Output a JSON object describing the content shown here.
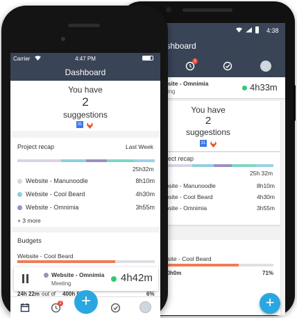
{
  "android": {
    "status_time": "4:38",
    "header_title": "Dashboard",
    "timer": {
      "project": "Website - Omnimia",
      "task": "Meeting",
      "time": "4h33m",
      "dot_color": "#2ecc71"
    },
    "clock_badge": "1",
    "suggestions": {
      "line1": "You have",
      "count": "2",
      "line2": "suggestions"
    },
    "recap": {
      "title": "Project recap",
      "total": "25h 32m",
      "items": [
        {
          "name": "Website - Manunoodle",
          "time": "8h10m",
          "color": "#d9d3e3"
        },
        {
          "name": "Website - Cool Beard",
          "time": "4h30m",
          "color": "#8fd0de"
        },
        {
          "name": "Website - Omnimia",
          "time": "3h55m",
          "color": "#9b8fc0"
        }
      ],
      "more": "+ 3 more"
    },
    "budget": {
      "name": "Website - Cool Beard",
      "of_text": "of",
      "total": "60h0m",
      "percent": "71%",
      "fill": 0.71
    },
    "fab_label": "+"
  },
  "iphone": {
    "carrier": "Carrier",
    "time": "4:47 PM",
    "header_title": "Dashboard",
    "suggestions": {
      "line1": "You have",
      "count": "2",
      "line2": "suggestions"
    },
    "recap": {
      "title": "Project recap",
      "period": "Last Week",
      "total": "25h32m",
      "items": [
        {
          "name": "Website - Manunoodle",
          "time": "8h10m",
          "color": "#d9d3e3"
        },
        {
          "name": "Website - Cool Beard",
          "time": "4h30m",
          "color": "#8fd0de"
        },
        {
          "name": "Website - Omnimia",
          "time": "3h55m",
          "color": "#9b8fc0"
        }
      ],
      "more": "+ 3 more"
    },
    "budgets": {
      "title": "Budgets",
      "item_name": "Website - Cool Beard",
      "fill": 0.71,
      "used": "24h 22m",
      "out_of": "out of",
      "total": "400h 0m",
      "percent": "6%"
    },
    "timer": {
      "project": "Website - Omnimia",
      "task": "Meeting",
      "time": "4h42m",
      "dot_color": "#2ecc71",
      "project_dot_color": "#9b8fc0"
    },
    "clock_badge": "1",
    "fab_label": "+"
  },
  "colors": {
    "header": "#394456",
    "accent": "#2aa7e0",
    "budget_bar": "#ef7c55",
    "running": "#2ecc71"
  }
}
